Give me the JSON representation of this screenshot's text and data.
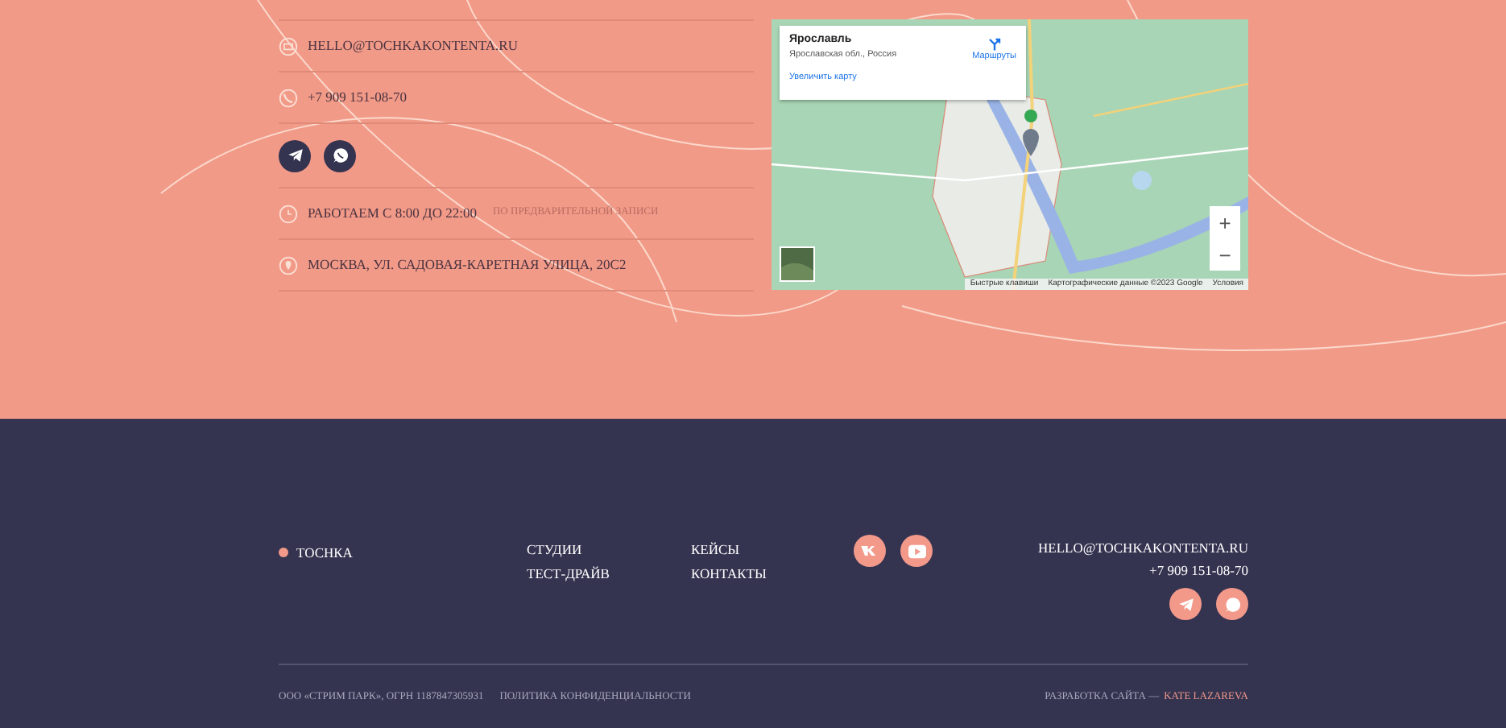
{
  "contacts": [
    {
      "kind": "email",
      "text": "HELLO@TOCHKAKONTENTA.RU"
    },
    {
      "kind": "phone",
      "text": "+7 909 151-08-70"
    },
    {
      "kind": "messengers",
      "items": [
        {
          "kind": "telegram"
        },
        {
          "kind": "whatsapp"
        }
      ]
    },
    {
      "kind": "hours",
      "text": "РАБОТАЕМ С 8:00 ДО 22:00",
      "note": "ПО ПРЕДВАРИТЕЛЬНОЙ ЗАПИСИ"
    },
    {
      "kind": "address",
      "text": "МОСКВА, УЛ. САДОВАЯ-КАРЕТНАЯ УЛИЦА, 20С2"
    }
  ],
  "map": {
    "place_title": "Ярославль",
    "place_subtitle": "Ярославская обл., Россия",
    "directions": "Маршруты",
    "enlarge": "Увеличить карту",
    "zoom_in": "+",
    "zoom_out": "−",
    "attribution": [
      "Быстрые клавиши",
      "Картографические данные ©2023 Google",
      "Условия"
    ]
  },
  "footer": {
    "brand": "ТОСНКА",
    "nav": [
      [
        "СТУДИИ",
        "ТЕСТ-ДРАЙВ"
      ],
      [
        "КЕЙСЫ",
        "КОНТАКТЫ"
      ]
    ],
    "social": [
      {
        "kind": "vk"
      },
      {
        "kind": "youtube"
      }
    ],
    "email": "HELLO@TOCHKAKONTENTA.RU",
    "phone": "+7 909 151-08-70",
    "messengers": [
      {
        "kind": "telegram"
      },
      {
        "kind": "whatsapp"
      }
    ],
    "legal": "ООО «СТРИМ ПАРК», ОГРН 1187847305931",
    "policy": "ПОЛИТИКА КОНФИДЕНЦИАЛЬНОСТИ",
    "credit": "РАЗРАБОТКА САЙТА —",
    "author": "KATE LAZAREVA"
  }
}
